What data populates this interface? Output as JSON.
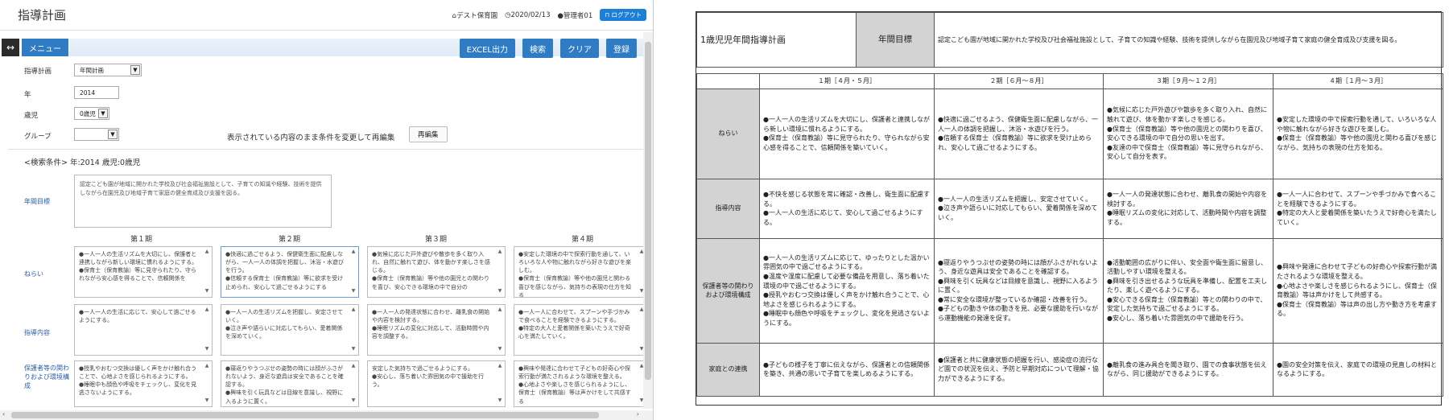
{
  "app": {
    "title": "指導計画",
    "facility": "デスト保育園",
    "date": "2020/02/13",
    "user": "管理者01",
    "logout": "ログアウト",
    "menu": "メニュー",
    "toggle_glyph": "↔",
    "buttons": {
      "excel": "EXCEL出力",
      "search": "検索",
      "clear": "クリア",
      "register": "登録"
    },
    "filters": {
      "plan_label": "指導計画",
      "plan_value": "年間計画",
      "year_label": "年",
      "year_value": "2014",
      "age_label": "歳児",
      "age_value": "0歳児",
      "group_label": "グループ",
      "group_value": "",
      "reedit_text": "表示されている内容のまま条件を変更して再編集",
      "reedit_button": "再編集"
    },
    "search_condition": "<検索条件> 年:2014 歳児:0歳児",
    "goal_label": "年間目標",
    "goal_text": "認定こども園が地域に開かれた学校及び社会福祉施設として、子育ての知識や経験、技術を提供しながら在園児及び地域子育て家庭の健全育成及び支援を図る。",
    "periods": [
      "第１期",
      "第２期",
      "第３期",
      "第４期"
    ],
    "rows": [
      {
        "label": "ねらい",
        "cells": [
          "●一人一人の生活リズムを大切にし、保護者と連携しながら新しい環境に慣れるようにする。\n●保育士（保育教諭）等に見守られたり、守られながら安心感を得ることで、信頼関係を",
          "●快適に過ごせるよう、保健衛生面に配慮しながら、一人一人の体調を把握し、沐浴・水遊びを行う。\n●信頼する保育士（保育教諭）等に欲求を受け止められ、安心して過ごせるようにする",
          "●気候に応じた戸外遊びや散歩を多く取り入れ、自然に触れて遊び、体を動かす楽しさを感じる。\n●保育士（保育教諭）等や他の園児との関わりを喜び、安心できる環境の中で自分の",
          "●安定した環境の中で探索行動を通して、いろいろな人や物に触れながら好きな遊びを楽しむ。\n●保育士（保育教諭）等や他の園児と関わる喜びを感じながら、気持ちの表現の仕方を知る"
        ]
      },
      {
        "label": "指導内容",
        "cells": [
          "●一人一人の生活に応じて、安心して過ごせるようにする。",
          "●一人一人の生活リズムを把握し、安定させていく。\n●泣き声や語らいに対応してもらい、愛着関係を深めていく。",
          "●一人一人の発達状態に合わせ、離乳食の開始や内容を検討する。\n●睡眠リズムの変化に対応して、活動時間や内容を調整する。",
          "●一人一人に合わせて、スプーンや手づかみで食べることを経験できるようにする。\n●特定の大人と愛着関係を築いたうえで好奇心を満たしていく。"
        ]
      },
      {
        "label": "保護者等の関わりおよび環境構成",
        "cells": [
          "●授乳やおむつ交換は優しく声をかけ触れ合うことで、心地よさを感じられるようにする。\n●睡眠中も顔色や呼吸をチェックし、変化を見逃さないようにする。",
          "●寝返りやうつぶせの姿勢の時には顔がふさがれないよう、身近な遊具は安全であることを確認する。\n●興味を引く玩具などは目線を意識し、視野に入るように置く。",
          "安定した気持ちで過ごせるようにする。\n●安心し、落ち着いた雰囲気の中で援助を行う。",
          "●興味や発達に合わせて子どもの好奇心や探索行動が満たされるような環境を整える。\n●心地よさや楽しさを感じられるようにし、保育士（保育教諭）等は声かけをして共感する"
        ]
      }
    ]
  },
  "doc": {
    "title": "1歳児児年間指導計画",
    "goal_header": "年間目標",
    "goal_text": "認定こども園が地域に開かれた学校及び社会福祉施設として、子育ての知識や経験、技術を提供しながら在園児及び地域子育て家庭の健全育成及び支援を図る。",
    "periods": [
      "１期［４月・５月］",
      "２期［６月～８月］",
      "３期［９月～１２月］",
      "４期［１月～３月］"
    ],
    "rows": [
      {
        "label": "ねらい",
        "cells": [
          "●一人一人の生活リズムを大切にし、保護者と連携しながら新しい環境に慣れるようにする。\n●保育士（保育教諭）等に見守られたり、守られながら安心感を得ることで、信頼関係を築いていく。",
          "●快適に過ごせるよう、保健衛生面に配慮しながら、一人一人の体調を把握し、沐浴・水遊びを行う。\n●信頼する保育士（保育教諭）等に欲求を受け止められ、安心して過ごせるようにする。",
          "●気候に応じた戸外遊びや散歩を多く取り入れ、自然に触れて遊び、体を動かす楽しさを感じる。\n●保育士（保育教諭）等や他の園児との関わりを喜び、安心できる環境の中で自分の思いを出す。\n●友達の中で保育士（保育教諭）等に見守られながら、安心して自分を表す。",
          "●安定した環境の中で探索行動を通して、いろいろな人や物に触れながら好きな遊びを楽しむ。\n●保育士（保育教諭）等や他の園児と関わる喜びを感じながら、気持ちの表現の仕方を知る。"
        ]
      },
      {
        "label": "指導内容",
        "cells": [
          "●不快を感じる状態を常に確認・改善し、衛生面に配慮する。\n●一人一人の生活に応じて、安心して過ごせるようにする。",
          "●一人一人の生活リズムを把握し、安定させていく。\n●泣き声や語らいに対応してもらい、愛着関係を深めていく。",
          "●一人一人の発達状態に合わせ、離乳食の開始や内容を検討する。\n●睡眠リズムの変化に対応して、活動時間や内容を調整する。",
          "●一人一人に合わせて、スプーンや手づかみで食べることを経験できるようにする。\n●特定の大人と愛着関係を築いたうえで好奇心を満たしていく。"
        ]
      },
      {
        "label": "保護者等の関わりおよび環境構成",
        "cells": [
          "●一人一人の生活リズムに応じて、ゆったりとした温かい雰囲気の中で過ごせるようにする。\n●温度や湿度に配慮して必要な備品を用意し、落ち着いた環境の中で過ごせるようにする。\n●授乳やおむつ交換は優しく声をかけ触れ合うことで、心地よさを感じられるようにする。\n●睡眠中も顔色や呼吸をチェックし、変化を見逃さないようにする。",
          "●寝返りやうつぶせの姿勢の時には顔がふさがれないよう、身近な遊具は安全であることを確認する。\n●興味を引く玩具などは目線を意識し、視野に入るように置く。\n●常に安全な環境が整っているか確認・改善を行う。\n●子どもの動きや体の動きを見、必要な援助を行いながら運動機能の発達を促す。",
          "●活動範囲の広がりに伴い、安全面や衛生面に留意し、活動しやすい環境を整える。\n●興味を引き出せるような玩具を準備し、配置を工夫したり、楽しく遊べるようにする。\n●安心できる保育士（保育教諭）等との関わりの中で、安定した気持ちで過ごせるようにする。\n●安心し、落ち着いた雰囲気の中で援助を行う。",
          "●興味や発達に合わせて子どもの好奇心や探索行動が満たされるような環境を整える。\n●心地よさや楽しさを感じられるようにし、保育士（保育教諭）等は声かけをして共感する。\n●保育士（保育教諭）等は声の出し方や動き方を考慮する。"
        ]
      },
      {
        "label": "家庭との連携",
        "cells": [
          "●子どもの様子を丁寧に伝えながら、保護者との信頼関係を築き、共通の思いで子育てを楽しめるようにする。",
          "●保護者と共に健康状態の把握を行い、感染症の流行など園での状況を伝え、予防と早期対応について理解・協力ができるようにする。",
          "●離乳食の進み具合を聞き取り、園での食事状態を伝えながら、同じ援助ができるようにする。",
          "●園の安全対策を伝え、家庭での環境の見直しの材料となるようにする。"
        ]
      }
    ]
  }
}
